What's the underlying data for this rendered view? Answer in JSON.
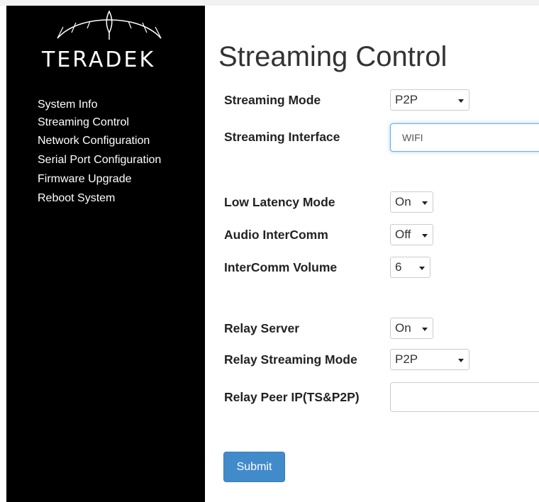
{
  "brand": {
    "logo_text": "TERADEK"
  },
  "sidebar": {
    "items": [
      {
        "label": "System Info"
      },
      {
        "label": "Streaming Control"
      },
      {
        "label": "Network Configuration"
      },
      {
        "label": "Serial Port Configuration"
      },
      {
        "label": "Firmware Upgrade"
      },
      {
        "label": "Reboot System"
      }
    ]
  },
  "page": {
    "title": "Streaming Control"
  },
  "form": {
    "streaming_mode": {
      "label": "Streaming Mode",
      "value": "P2P"
    },
    "streaming_interface": {
      "label": "Streaming Interface",
      "value": "WIFI"
    },
    "low_latency_mode": {
      "label": "Low Latency Mode",
      "value": "On"
    },
    "audio_intercomm": {
      "label": "Audio InterComm",
      "value": "Off"
    },
    "intercomm_volume": {
      "label": "InterComm Volume",
      "value": "6"
    },
    "relay_server": {
      "label": "Relay Server",
      "value": "On"
    },
    "relay_streaming_mode": {
      "label": "Relay Streaming Mode",
      "value": "P2P"
    },
    "relay_peer_ip": {
      "label": "Relay Peer IP(TS&P2P)",
      "value": ""
    },
    "submit_label": "Submit"
  },
  "colors": {
    "sidebar_bg": "#000000",
    "button_bg": "#428bca",
    "focus_border": "#66afe9"
  }
}
